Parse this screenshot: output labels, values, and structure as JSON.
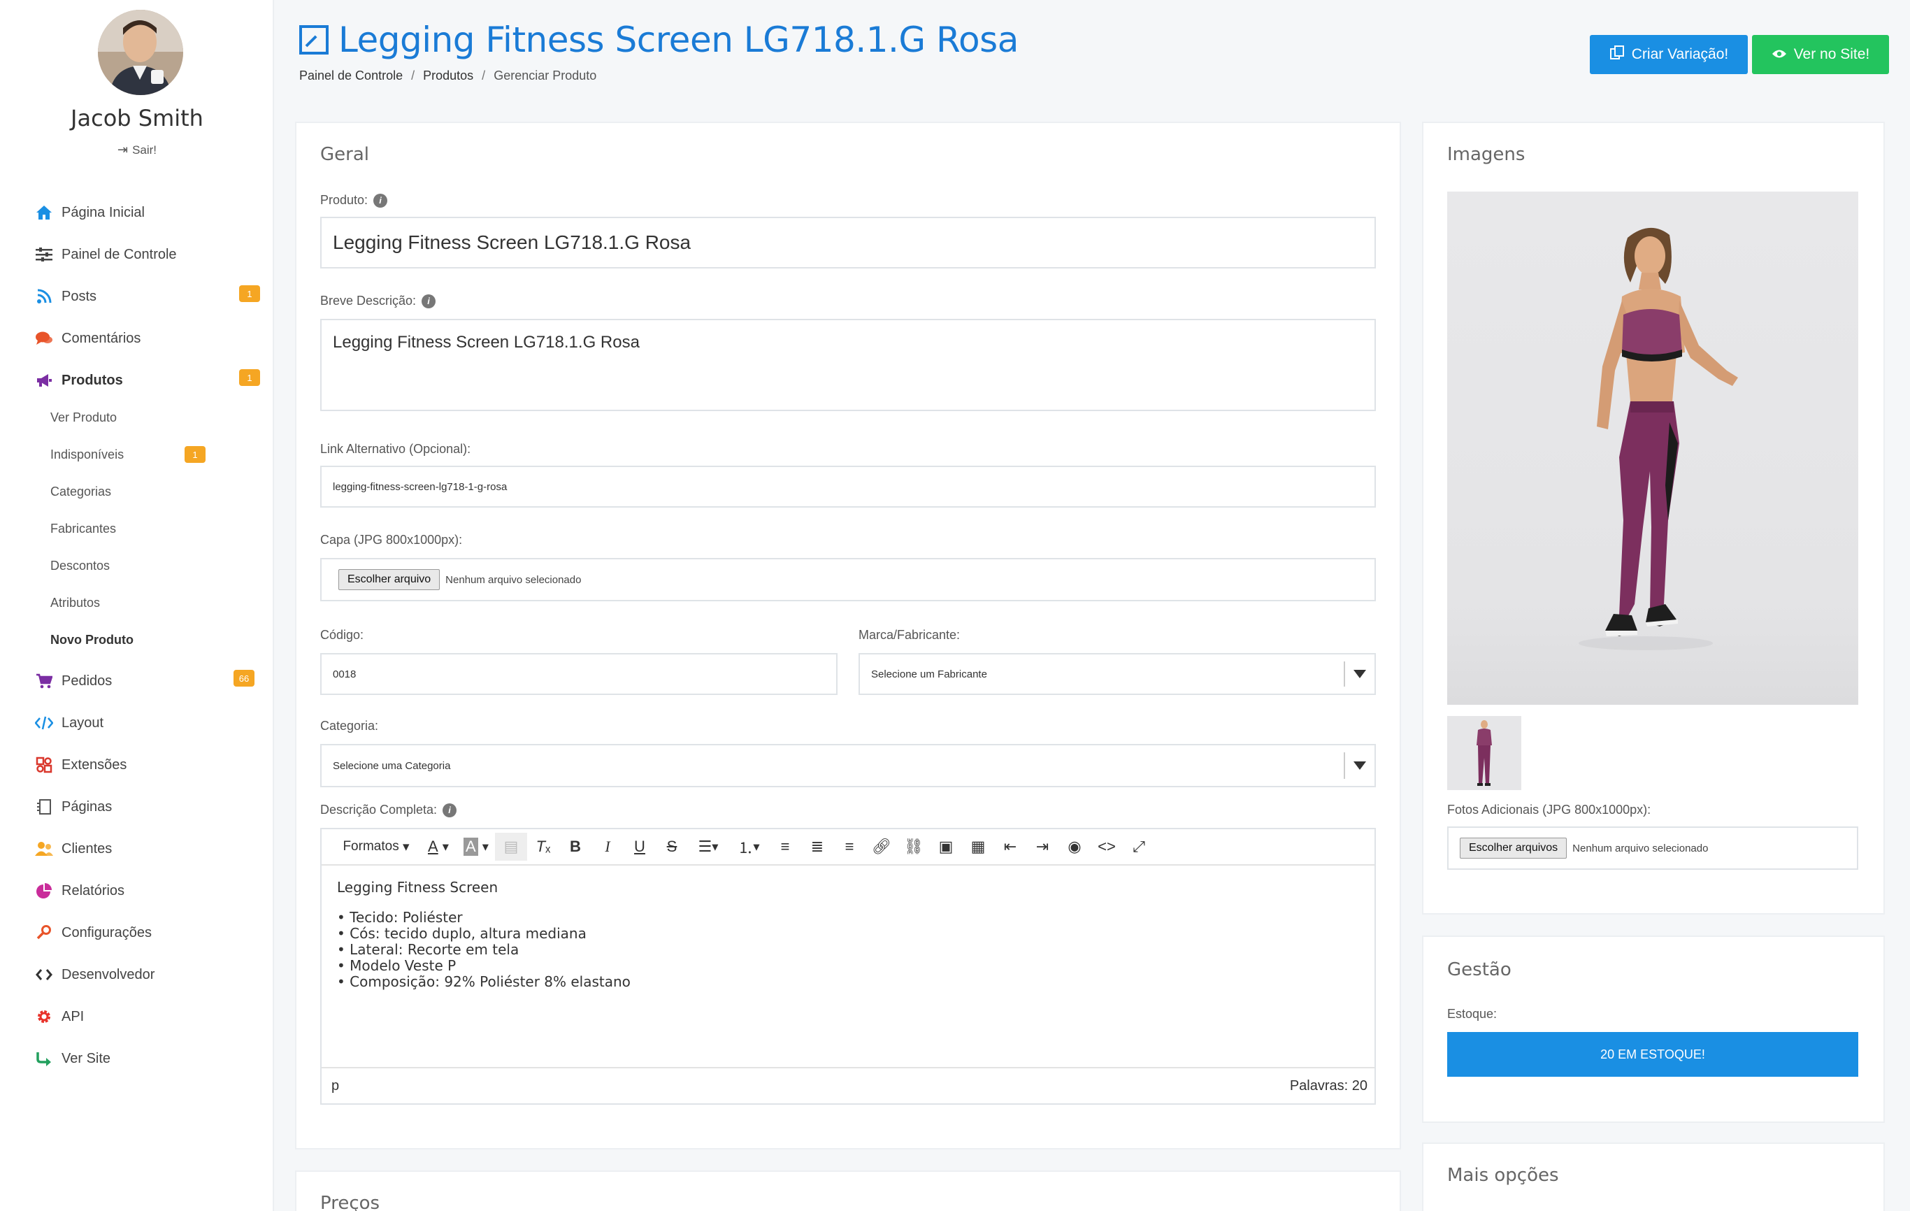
{
  "user": {
    "name": "Jacob Smith",
    "logout_label": "Sair!"
  },
  "nav": {
    "items": [
      {
        "label": "Página Inicial",
        "icon": "home-icon",
        "color": "#1a8fe3"
      },
      {
        "label": "Painel de Controle",
        "icon": "sliders-icon",
        "color": "#444444"
      },
      {
        "label": "Posts",
        "icon": "rss-icon",
        "color": "#1a8fe3",
        "badge": "1"
      },
      {
        "label": "Comentários",
        "icon": "comments-icon",
        "color": "#e8542a"
      },
      {
        "label": "Produtos",
        "icon": "megaphone-icon",
        "color": "#7b2ea3",
        "badge": "1"
      },
      {
        "label": "Pedidos",
        "icon": "cart-icon",
        "color": "#7b2ea3",
        "badge": "66"
      },
      {
        "label": "Layout",
        "icon": "code-icon",
        "color": "#1a8fe3"
      },
      {
        "label": "Extensões",
        "icon": "puzzle-icon",
        "color": "#d9372c"
      },
      {
        "label": "Páginas",
        "icon": "pages-icon",
        "color": "#555555"
      },
      {
        "label": "Clientes",
        "icon": "users-icon",
        "color": "#f5a623"
      },
      {
        "label": "Relatórios",
        "icon": "pie-chart-icon",
        "color": "#c92c9a"
      },
      {
        "label": "Configurações",
        "icon": "settings-icon",
        "color": "#e8542a"
      },
      {
        "label": "Desenvolvedor",
        "icon": "dev-icon",
        "color": "#333333"
      },
      {
        "label": "API",
        "icon": "gear-icon",
        "color": "#e8322a"
      },
      {
        "label": "Ver Site",
        "icon": "share-icon",
        "color": "#23a05e"
      }
    ],
    "products_sub": [
      {
        "label": "Ver Produto"
      },
      {
        "label": "Indisponíveis",
        "badge": "1"
      },
      {
        "label": "Categorias"
      },
      {
        "label": "Fabricantes"
      },
      {
        "label": "Descontos"
      },
      {
        "label": "Atributos"
      },
      {
        "label": "Novo Produto"
      }
    ]
  },
  "header": {
    "title": "Legging Fitness Screen LG718.1.G Rosa",
    "breadcrumb": [
      "Painel de Controle",
      "Produtos",
      "Gerenciar Produto"
    ],
    "btn_variation": "Criar Variação!",
    "btn_site": "Ver no Site!"
  },
  "general": {
    "heading": "Geral",
    "product_label": "Produto:",
    "product_value": "Legging Fitness Screen LG718.1.G Rosa",
    "short_desc_label": "Breve Descrição:",
    "short_desc_value": "Legging Fitness Screen LG718.1.G Rosa",
    "alt_link_label": "Link Alternativo (Opcional):",
    "alt_link_value": "legging-fitness-screen-lg718-1-g-rosa",
    "cover_label": "Capa (JPG 800x1000px):",
    "file_btn": "Escolher arquivo",
    "file_none": "Nenhum arquivo selecionado",
    "code_label": "Código:",
    "code_value": "0018",
    "brand_label": "Marca/Fabricante:",
    "brand_placeholder": "Selecione um Fabricante",
    "category_label": "Categoria:",
    "category_placeholder": "Selecione uma Categoria",
    "full_desc_label": "Descrição Completa:"
  },
  "editor": {
    "formats": "Formatos",
    "content_title": "Legging Fitness Screen",
    "bullets": [
      "• Tecido: Poliéster",
      "• Cós: tecido duplo, altura mediana",
      "• Lateral: Recorte em tela",
      "• Modelo Veste P",
      "• Composição: 92% Poliéster 8% elastano"
    ],
    "path": "p",
    "word_count": "Palavras: 20"
  },
  "prices": {
    "heading": "Preços"
  },
  "images": {
    "heading": "Imagens",
    "additional_label": "Fotos Adicionais (JPG 800x1000px):",
    "files_btn": "Escolher arquivos",
    "files_none": "Nenhum arquivo selecionado"
  },
  "management": {
    "heading": "Gestão",
    "stock_label": "Estoque:",
    "stock_btn": "20 EM ESTOQUE!"
  },
  "more": {
    "heading": "Mais opções"
  },
  "colors": {
    "primary": "#1a8fe3",
    "success": "#23c45e",
    "badge": "#f5a623",
    "title": "#1a7bd6"
  }
}
